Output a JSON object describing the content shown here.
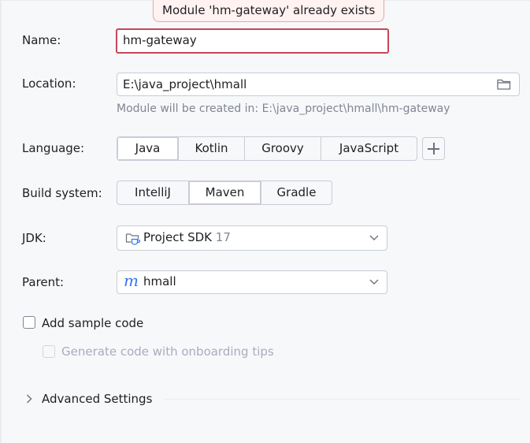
{
  "tooltip": {
    "error_message": "Module 'hm-gateway' already exists"
  },
  "name": {
    "label": "Name:",
    "value": "hm-gateway"
  },
  "location": {
    "label": "Location:",
    "value": "E:\\java_project\\hmall",
    "hint": "Module will be created in: E:\\java_project\\hmall\\hm-gateway"
  },
  "language": {
    "label": "Language:",
    "options": [
      "Java",
      "Kotlin",
      "Groovy",
      "JavaScript"
    ],
    "selected": "Java"
  },
  "build_system": {
    "label": "Build system:",
    "options": [
      "IntelliJ",
      "Maven",
      "Gradle"
    ],
    "selected": "Maven"
  },
  "jdk": {
    "label": "JDK:",
    "value": "Project SDK",
    "version": "17"
  },
  "parent": {
    "label": "Parent:",
    "icon_letter": "m",
    "value": "hmall"
  },
  "sample_code": {
    "label": "Add sample code",
    "checked": false
  },
  "onboarding_tips": {
    "label": "Generate code with onboarding tips",
    "checked": false,
    "enabled": false
  },
  "advanced_settings": {
    "label": "Advanced Settings"
  },
  "colors": {
    "error_border": "#c84659",
    "tooltip_bg": "#fff2f1",
    "maven_icon": "#3574f0"
  }
}
